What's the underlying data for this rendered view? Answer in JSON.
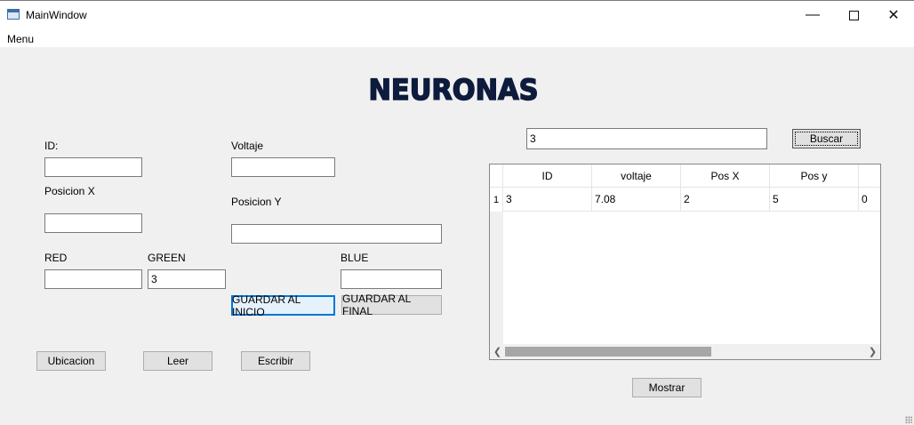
{
  "window": {
    "title": "MainWindow",
    "controls": [
      "minimize-icon",
      "maximize-icon",
      "close-icon"
    ]
  },
  "menu": {
    "label": "Menu"
  },
  "heading": "NEURONAS",
  "form": {
    "id_label": "ID:",
    "id_value": "",
    "voltaje_label": "Voltaje",
    "voltaje_value": "",
    "posx_label": "Posicion X",
    "posx_value": "",
    "posy_label": "Posicion Y",
    "posy_value": "",
    "red_label": "RED",
    "red_value": "",
    "green_label": "GREEN",
    "green_value": "3",
    "blue_label": "BLUE",
    "blue_value": ""
  },
  "buttons": {
    "guardar_inicio": "GUARDAR AL INICIO",
    "guardar_final": "GUARDAR AL FINAL",
    "ubicacion": "Ubicacion",
    "leer": "Leer",
    "escribir": "Escribir",
    "buscar": "Buscar",
    "mostrar": "Mostrar"
  },
  "search": {
    "value": "3"
  },
  "table": {
    "columns": [
      "ID",
      "voltaje",
      "Pos X",
      "Pos y",
      ""
    ],
    "rows": [
      {
        "header": "1",
        "cells": [
          "3",
          "7.08",
          "2",
          "5",
          "0"
        ]
      }
    ]
  },
  "colors": {
    "heading": "#0d1b3d",
    "focus_accent": "#0078d7",
    "background": "#f0f0f0"
  }
}
